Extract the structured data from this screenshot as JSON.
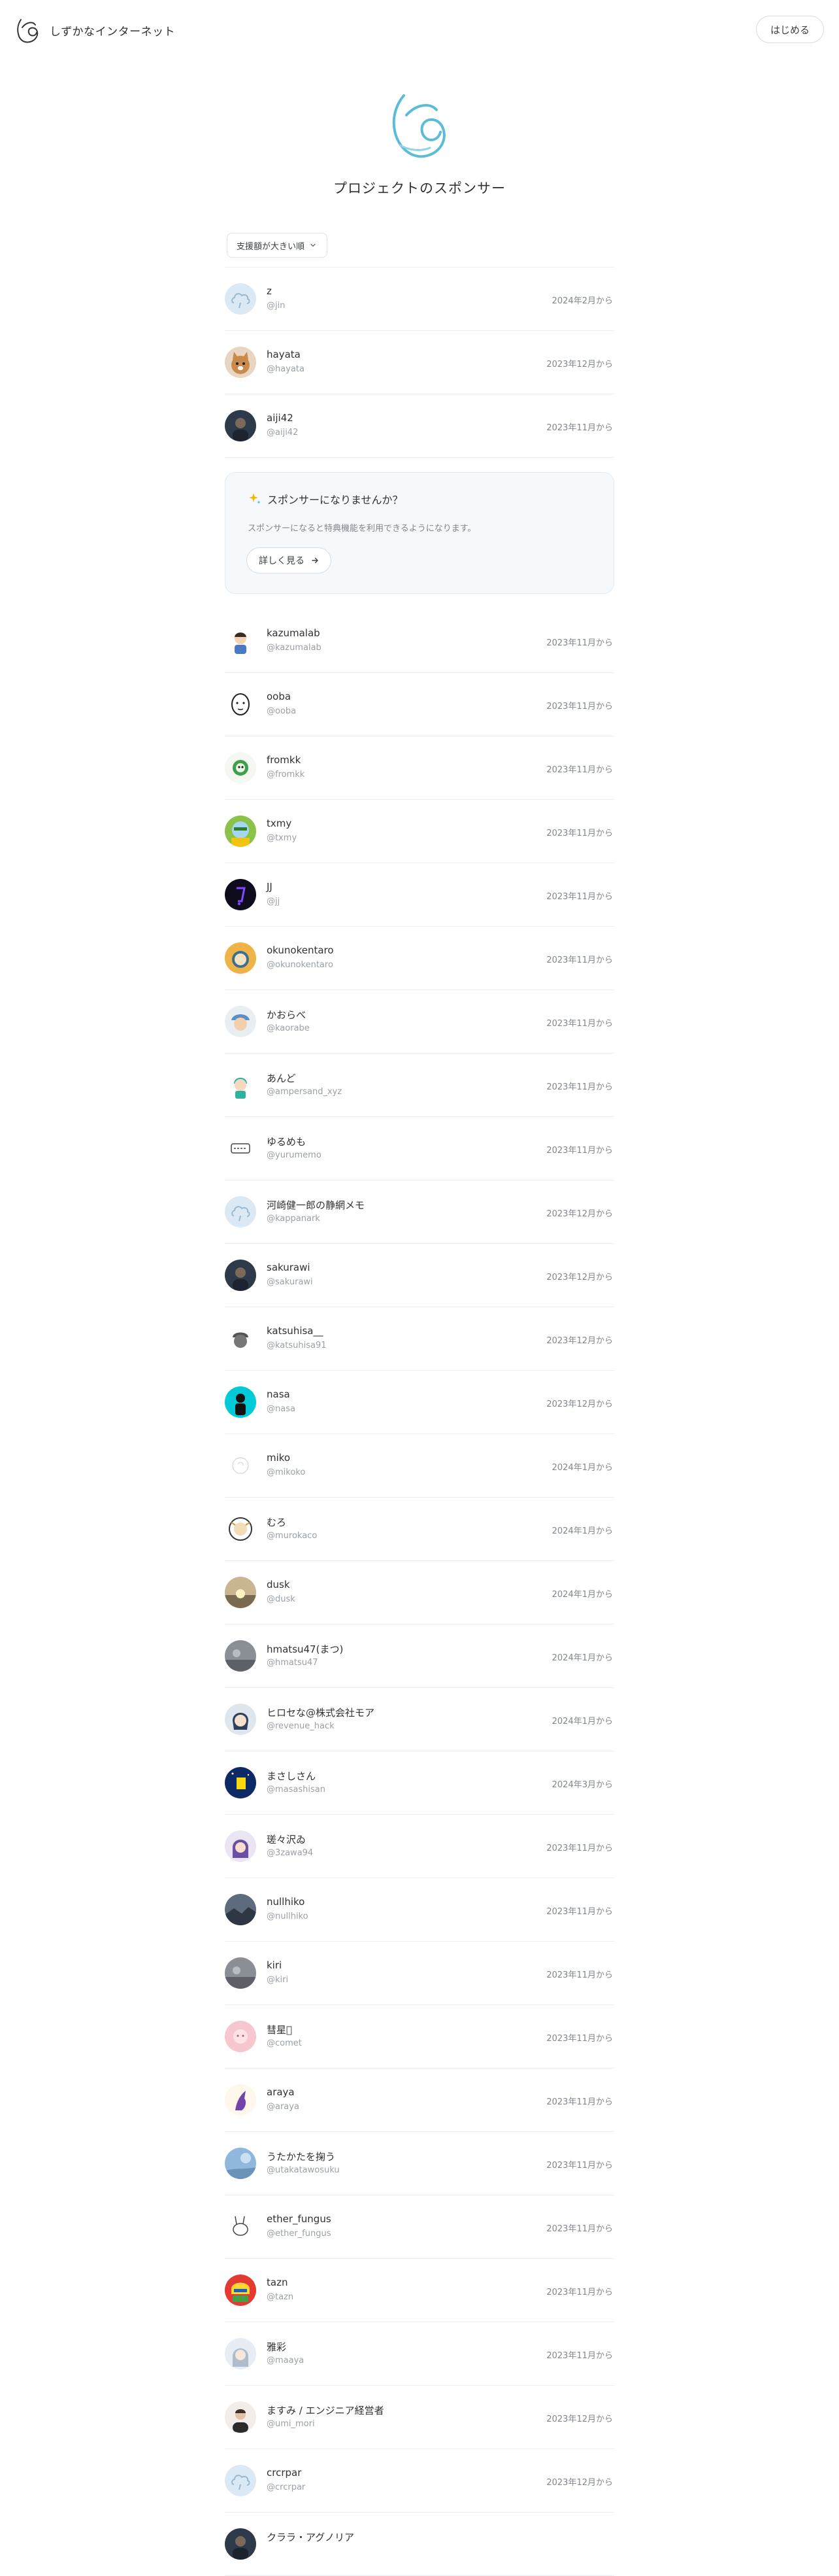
{
  "header": {
    "brand_name": "しずかなインターネット",
    "start_label": "はじめる"
  },
  "page_title": "プロジェクトのスポンサー",
  "sort": {
    "label": "支援額が大きい順"
  },
  "promo": {
    "title": "スポンサーになりませんか？",
    "description": "スポンサーになると特典機能を利用できるようになります。",
    "button_label": "詳しく見る"
  },
  "colors": {
    "accent": "#5bbcd8",
    "border": "#edeef0",
    "promo_bg": "#f5f9fc",
    "muted_text": "#9aa0a6"
  },
  "sponsors_top": [
    {
      "name": "z",
      "handle": "@jin",
      "since": "2024年2月から",
      "avatar": "default-cloud"
    },
    {
      "name": "hayata",
      "handle": "@hayata",
      "since": "2023年12月から",
      "avatar": "cat"
    },
    {
      "name": "aiji42",
      "handle": "@aiji42",
      "since": "2023年11月から",
      "avatar": "photo-dark"
    }
  ],
  "sponsors": [
    {
      "name": "kazumalab",
      "handle": "@kazumalab",
      "since": "2023年11月から",
      "avatar": "character"
    },
    {
      "name": "ooba",
      "handle": "@ooba",
      "since": "2023年11月から",
      "avatar": "line-face"
    },
    {
      "name": "fromkk",
      "handle": "@fromkk",
      "since": "2023年11月から",
      "avatar": "green-character"
    },
    {
      "name": "txmy",
      "handle": "@txmy",
      "since": "2023年11月から",
      "avatar": "green-face"
    },
    {
      "name": "JJ",
      "handle": "@jj",
      "since": "2023年11月から",
      "avatar": "dark-glyph"
    },
    {
      "name": "okunokentaro",
      "handle": "@okunokentaro",
      "since": "2023年11月から",
      "avatar": "orange-face"
    },
    {
      "name": "かおらべ",
      "handle": "@kaorabe",
      "since": "2023年11月から",
      "avatar": "cap-face"
    },
    {
      "name": "あんど",
      "handle": "@ampersand_xyz",
      "since": "2023年11月から",
      "avatar": "teal-character"
    },
    {
      "name": "ゆるめも",
      "handle": "@yurumemo",
      "since": "2023年11月から",
      "avatar": "text-logo"
    },
    {
      "name": "河崎健一郎の静網メモ",
      "handle": "@kappanark",
      "since": "2023年12月から",
      "avatar": "default-cloud"
    },
    {
      "name": "sakurawi",
      "handle": "@sakurawi",
      "since": "2023年12月から",
      "avatar": "photo-dark"
    },
    {
      "name": "katsuhisa__",
      "handle": "@katsuhisa91",
      "since": "2023年12月から",
      "avatar": "hat-character"
    },
    {
      "name": "nasa",
      "handle": "@nasa",
      "since": "2023年12月から",
      "avatar": "cyan-figure"
    },
    {
      "name": "miko",
      "handle": "@mikoko",
      "since": "2024年1月から",
      "avatar": "faint-sketch"
    },
    {
      "name": "むろ",
      "handle": "@murokaco",
      "since": "2024年1月から",
      "avatar": "ornate"
    },
    {
      "name": "dusk",
      "handle": "@dusk",
      "since": "2024年1月から",
      "avatar": "sunset"
    },
    {
      "name": "hmatsu47(まつ)",
      "handle": "@hmatsu47",
      "since": "2024年1月から",
      "avatar": "photo-grey"
    },
    {
      "name": "ヒロセな@株式会社モア",
      "handle": "@revenue_hack",
      "since": "2024年1月から",
      "avatar": "anime-face"
    },
    {
      "name": "まさしさん",
      "handle": "@masashisan",
      "since": "2024年3月から",
      "avatar": "night-yellow"
    },
    {
      "name": "瑳々沢ゐ",
      "handle": "@3zawa94",
      "since": "2023年11月から",
      "avatar": "purple-anime"
    },
    {
      "name": "nullhiko",
      "handle": "@nullhiko",
      "since": "2023年11月から",
      "avatar": "photo-landscape"
    },
    {
      "name": "kiri",
      "handle": "@kiri",
      "since": "2023年11月から",
      "avatar": "photo-grey"
    },
    {
      "name": "彗星\u0000",
      "handle": "@comet",
      "since": "2023年11月から",
      "avatar": "pink-face"
    },
    {
      "name": "araya",
      "handle": "@araya",
      "since": "2023年11月から",
      "avatar": "purple-cat"
    },
    {
      "name": "うたかたを掬う",
      "handle": "@utakatawosuku",
      "since": "2023年11月から",
      "avatar": "sky-blue"
    },
    {
      "name": "ether_fungus",
      "handle": "@ether_fungus",
      "since": "2023年11月から",
      "avatar": "sketch-rabbit"
    },
    {
      "name": "tazn",
      "handle": "@tazn",
      "since": "2023年11月から",
      "avatar": "colorful-mask"
    },
    {
      "name": "雅彩",
      "handle": "@maaya",
      "since": "2023年11月から",
      "avatar": "anime-girl"
    },
    {
      "name": "ますみ / エンジニア経営者",
      "handle": "@umi_mori",
      "since": "2023年12月から",
      "avatar": "photo-person"
    },
    {
      "name": "crcrpar",
      "handle": "@crcrpar",
      "since": "2023年12月から",
      "avatar": "default-cloud"
    },
    {
      "name": "クララ・アグノリア",
      "handle": "",
      "since": "",
      "avatar": "photo-dark"
    }
  ]
}
